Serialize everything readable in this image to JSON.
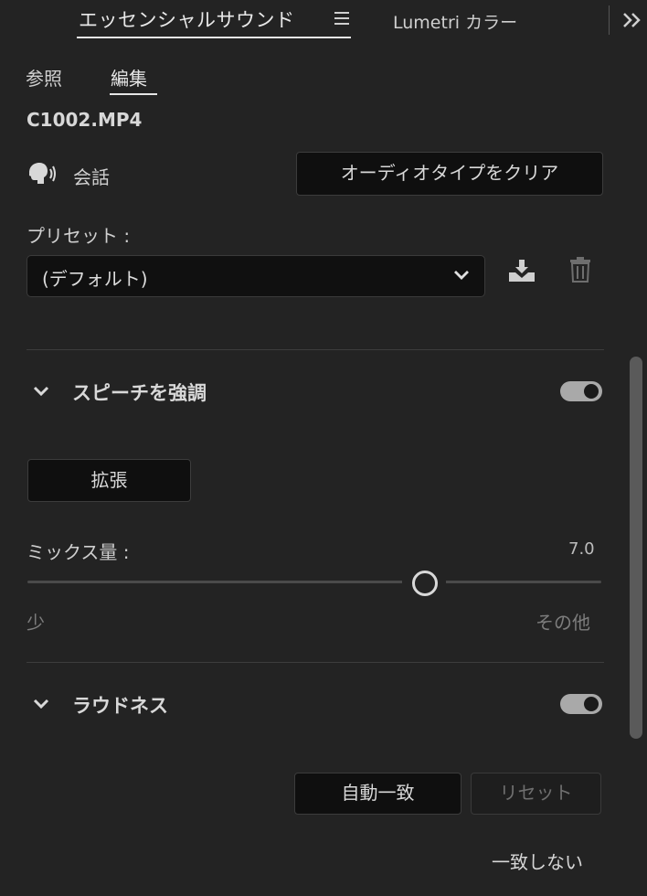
{
  "tabs": {
    "active_label": "エッセンシャルサウンド",
    "inactive_label": "Lumetri カラー"
  },
  "subtabs": {
    "browse": "参照",
    "edit": "編集"
  },
  "clip": {
    "name": "C1002.MP4"
  },
  "audio_type": {
    "label": "会話",
    "clear_button": "オーディオタイプをクリア"
  },
  "preset": {
    "label": "プリセット :",
    "value": "(デフォルト)"
  },
  "enhance_speech": {
    "title": "スピーチを強調",
    "enabled": true,
    "expand_button": "拡張",
    "mix_label": "ミックス量 :",
    "mix_value": "7.0",
    "slider_fraction": 0.7,
    "range_min": "少",
    "range_max": "その他"
  },
  "loudness": {
    "title": "ラウドネス",
    "enabled": true,
    "auto_match_button": "自動一致",
    "reset_button": "リセット",
    "status": "一致しない"
  },
  "colors": {
    "background": "#232323",
    "toggle_on": "#a9a9a9"
  },
  "icons": {
    "menu": "hamburger-icon",
    "overflow": "double-chevron-right-icon",
    "dialogue": "speaking-head-icon",
    "dropdown": "chevron-down-icon",
    "save": "save-preset-icon",
    "delete": "trash-icon"
  }
}
